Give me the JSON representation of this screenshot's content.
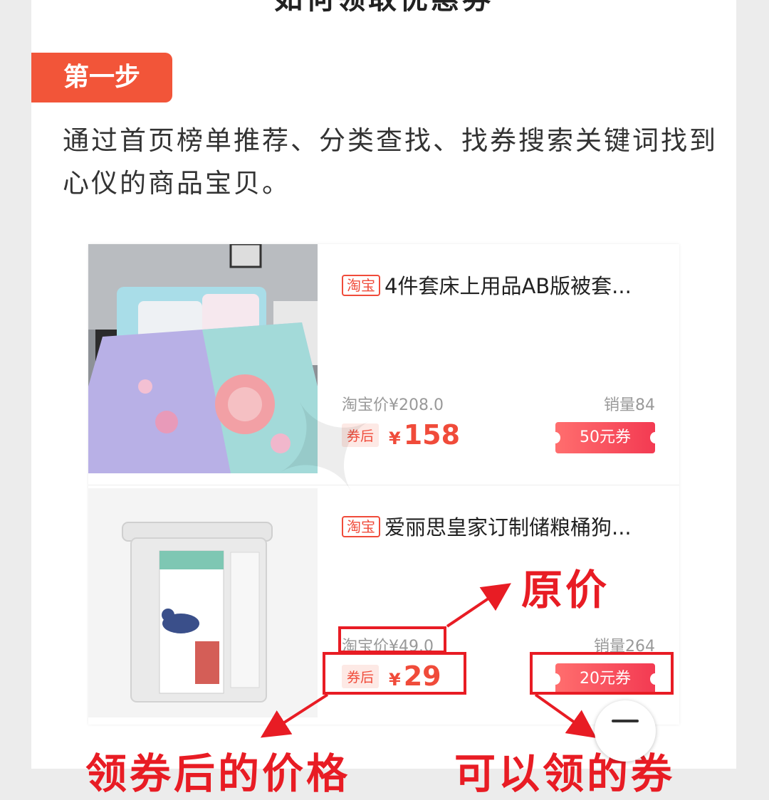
{
  "header": {
    "title_cut": "如何领取优惠券"
  },
  "step": {
    "label": "第一步"
  },
  "intro": {
    "text": "通过首页榜单推荐、分类查找、找券搜索关键词找到心仪的商品宝贝。"
  },
  "products": [
    {
      "badge": "淘宝",
      "title": "4件套床上用品AB版被套...",
      "orig_label": "淘宝价¥208.0",
      "sales": "销量84",
      "after_label": "券后",
      "currency": "¥",
      "after_price": "158",
      "coupon": "50元券"
    },
    {
      "badge": "淘宝",
      "title": "爱丽思皇家订制储粮桶狗...",
      "orig_label": "淘宝价¥49.0",
      "sales": "销量264",
      "after_label": "券后",
      "currency": "¥",
      "after_price": "29",
      "coupon": "20元券"
    }
  ],
  "annotations": {
    "original_price": "原价",
    "after_coupon_price": "领券后的价格",
    "coupon_available": "可以领的券"
  },
  "colors": {
    "accent": "#f25539",
    "annot_red": "#e81c24"
  },
  "icons": {
    "fab": "minus-icon"
  }
}
